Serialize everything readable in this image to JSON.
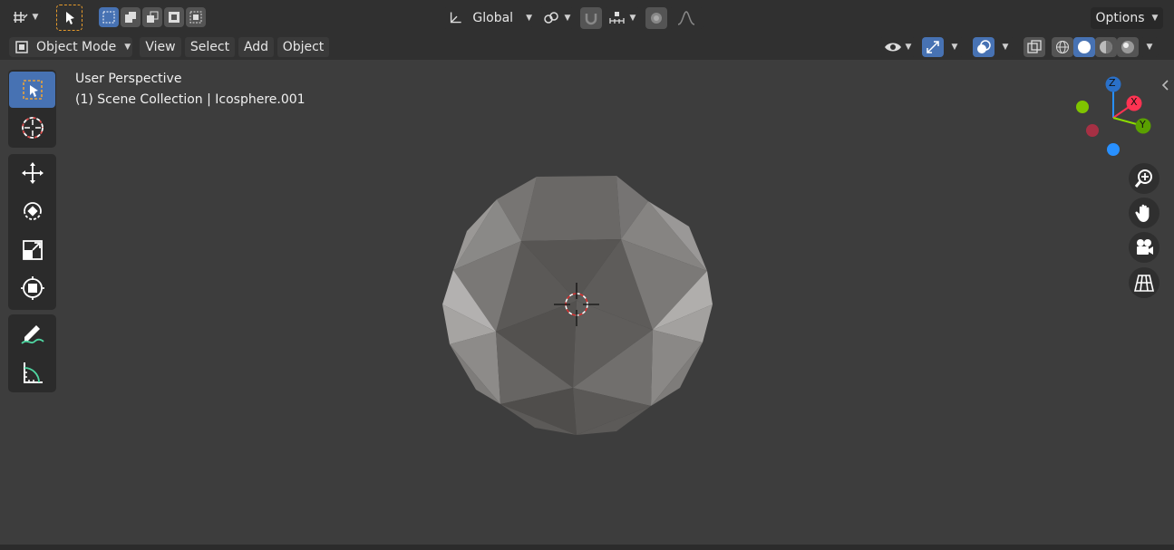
{
  "header": {
    "editor_type_icon": "editor-type-icon",
    "transform_orientation": "Global",
    "options_label": "Options"
  },
  "menu": {
    "mode": "Object Mode",
    "view": "View",
    "select": "Select",
    "add": "Add",
    "object": "Object"
  },
  "viewport_info": {
    "perspective": "User Perspective",
    "collection": "(1) Scene Collection | Icosphere.001"
  },
  "gizmo": {
    "x_label": "X",
    "y_label": "Y",
    "z_label": "Z",
    "x_color": "#ff3352",
    "y_color": "#8bdc00",
    "z_color": "#2890ff"
  },
  "tools": [
    "select-box",
    "cursor",
    "move",
    "rotate",
    "scale",
    "transform",
    "annotate",
    "measure"
  ],
  "colors": {
    "accent": "#4772b3",
    "background": "#3d3d3d",
    "header": "#303030"
  }
}
